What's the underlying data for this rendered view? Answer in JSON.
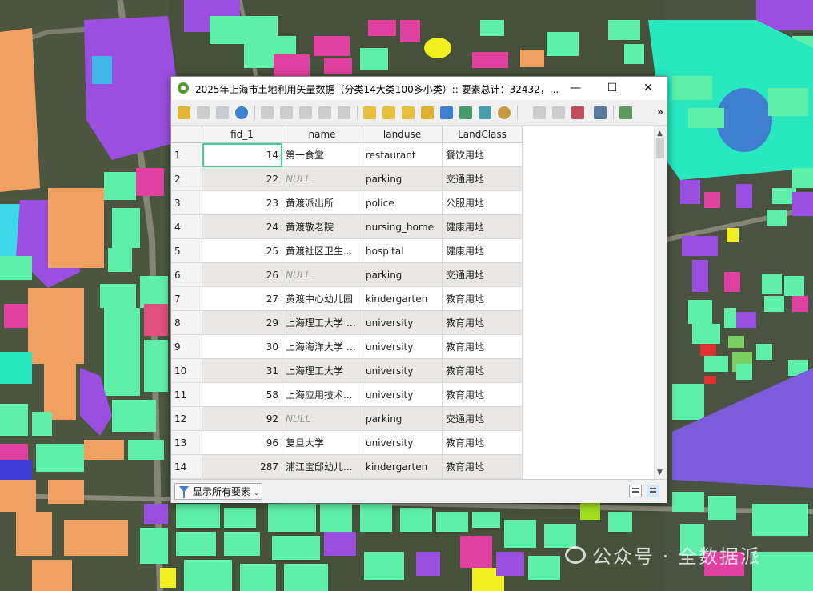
{
  "window": {
    "title": "2025年上海市土地利用矢量数据（分类14大类100多小类）:: 要素总计：32432，...",
    "min_glyph": "—",
    "max_glyph": "☐",
    "close_glyph": "✕"
  },
  "toolbar": {
    "more_glyph": "»",
    "icons": [
      "edit-pencil-icon",
      "multi-edit-icon",
      "save-edits-icon",
      "reload-icon",
      "add-feature-icon",
      "delete-feature-icon",
      "cut-icon",
      "copy-icon",
      "paste-icon",
      "select-expression-icon",
      "select-all-icon",
      "invert-selection-icon",
      "deselect-icon",
      "filter-icon",
      "move-top-icon",
      "pan-to-icon",
      "zoom-to-icon",
      "new-field-icon",
      "delete-field-icon",
      "field-calculator-icon",
      "conditional-format-icon",
      "actions-icon"
    ]
  },
  "table": {
    "columns": [
      "fid_1",
      "name",
      "landuse",
      "LandClass"
    ],
    "null_text": "NULL",
    "rows": [
      {
        "n": "1",
        "fid": "14",
        "name": "第一食堂",
        "landuse": "restaurant",
        "cls": "餐饮用地"
      },
      {
        "n": "2",
        "fid": "22",
        "name": "",
        "landuse": "parking",
        "cls": "交通用地"
      },
      {
        "n": "3",
        "fid": "23",
        "name": "黄渡派出所",
        "landuse": "police",
        "cls": "公服用地"
      },
      {
        "n": "4",
        "fid": "24",
        "name": "黄渡敬老院",
        "landuse": "nursing_home",
        "cls": "健康用地"
      },
      {
        "n": "5",
        "fid": "25",
        "name": "黄渡社区卫生...",
        "landuse": "hospital",
        "cls": "健康用地"
      },
      {
        "n": "6",
        "fid": "26",
        "name": "",
        "landuse": "parking",
        "cls": "交通用地"
      },
      {
        "n": "7",
        "fid": "27",
        "name": "黄渡中心幼儿园",
        "landuse": "kindergarten",
        "cls": "教育用地"
      },
      {
        "n": "8",
        "fid": "29",
        "name": "上海理工大学 (...",
        "landuse": "university",
        "cls": "教育用地"
      },
      {
        "n": "9",
        "fid": "30",
        "name": "上海海洋大学 (...",
        "landuse": "university",
        "cls": "教育用地"
      },
      {
        "n": "10",
        "fid": "31",
        "name": "上海理工大学",
        "landuse": "university",
        "cls": "教育用地"
      },
      {
        "n": "11",
        "fid": "58",
        "name": "上海应用技术...",
        "landuse": "university",
        "cls": "教育用地"
      },
      {
        "n": "12",
        "fid": "92",
        "name": "",
        "landuse": "parking",
        "cls": "交通用地"
      },
      {
        "n": "13",
        "fid": "96",
        "name": "复旦大学",
        "landuse": "university",
        "cls": "教育用地"
      },
      {
        "n": "14",
        "fid": "287",
        "name": "浦江宝邸幼儿...",
        "landuse": "kindergarten",
        "cls": "教育用地"
      }
    ]
  },
  "bottom": {
    "filter_label": "显示所有要素",
    "caret": "⌄"
  },
  "scroll": {
    "up": "▲",
    "down": "▼"
  },
  "watermark": {
    "text": "公众号 · 全数据派"
  },
  "colors": {
    "map_green": "#5ef0a8",
    "map_purple": "#9b4fe0",
    "map_orange": "#f0a060",
    "map_magenta": "#e040a0",
    "map_teal": "#28e8c0",
    "selection_outline": "#3fd19b"
  }
}
